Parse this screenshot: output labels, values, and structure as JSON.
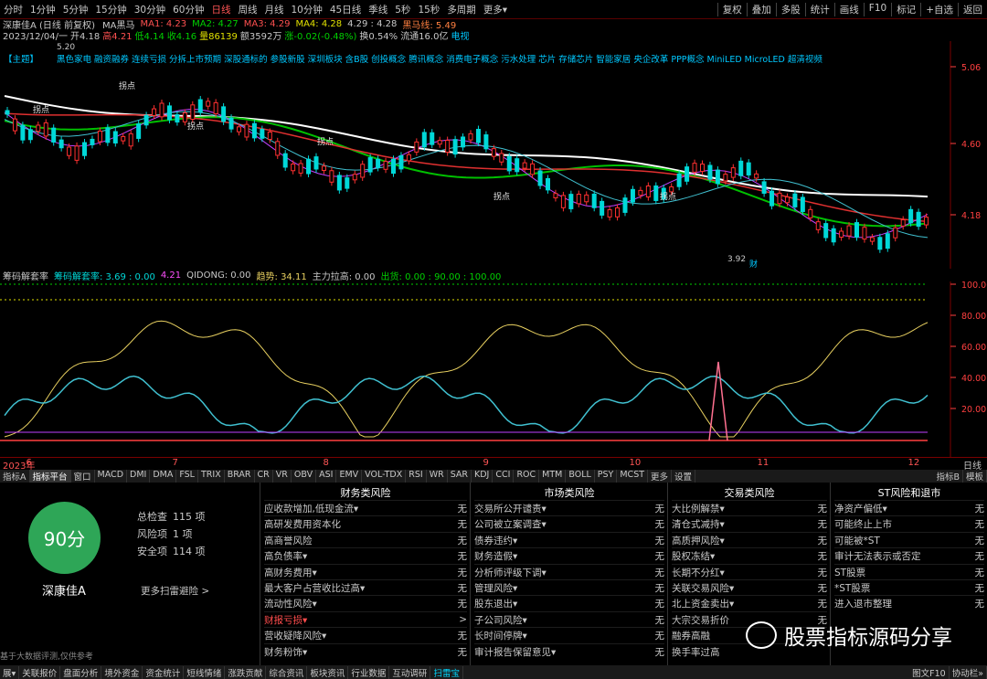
{
  "toolbar": {
    "periods": [
      "分时",
      "1分钟",
      "5分钟",
      "15分钟",
      "30分钟",
      "60分钟",
      "日线",
      "周线",
      "月线",
      "10分钟",
      "45日线",
      "季线",
      "5秒",
      "15秒",
      "多周期",
      "更多▾"
    ],
    "active_period": "日线",
    "right": [
      "复权",
      "叠加",
      "多股",
      "统计",
      "画线",
      "F10",
      "标记",
      "+自选",
      "返回"
    ]
  },
  "title_line": {
    "name": "深康佳A (日线 前复权)",
    "ma_label": "MA黑马",
    "ma1": "MA1: 4.23",
    "ma2": "MA2: 4.27",
    "ma3": "MA3: 4.29",
    "ma4": "MA4: 4.28",
    "extra": "4.29 : 4.28",
    "heima": "黑马线: 5.49"
  },
  "info_line": {
    "date": "2023/12/04/一",
    "open": "开4.18",
    "high": "高4.21",
    "low": "低4.14",
    "close": "收4.16",
    "vol": "量86139",
    "amount": "额3592万",
    "change": "涨-0.02(-0.48%)",
    "turnover": "换0.54%",
    "float": "流通16.0亿",
    "tv": "电视"
  },
  "concept_line": {
    "tag": "【主题】",
    "text": "黑色家电 融资融券 连续亏损 分拆上市预期 深股通标的 参股新股 深圳板块 含B股 创投概念 腾讯概念 消费电子概念 污水处理 芯片 存储芯片 智能家居 央企改革 PPP概念 MiniLED MicroLED 超清视频"
  },
  "price_axis": [
    "5.06",
    "4.60",
    "4.18"
  ],
  "price_marks": {
    "high": "5.20",
    "low": "3.92",
    "cai": "财"
  },
  "pick_labels": [
    "拐点",
    "拐点",
    "拐点",
    "拐点",
    "拐点",
    "拐点"
  ],
  "indicator_header": {
    "name": "筹码解套率",
    "v1": "筹码解套率: 3.69 : 0.00",
    "v2": "4.21",
    "qidong": "QIDONG: 0.00",
    "trend": "趋势: 34.11",
    "main": "主力拉高: 0.00",
    "out": "出货: 0.00 : 90.00 : 100.00"
  },
  "indicator_axis": [
    "100.00",
    "80.00",
    "60.00",
    "40.00",
    "20.00"
  ],
  "date_axis": {
    "year": "2023年",
    "months": [
      "6",
      "7",
      "8",
      "9",
      "10",
      "11",
      "12"
    ],
    "right": "日线"
  },
  "indicator_tabs": [
    "指标A",
    "指标平台",
    "窗口",
    "MACD",
    "DMI",
    "DMA",
    "FSL",
    "TRIX",
    "BRAR",
    "CR",
    "VR",
    "OBV",
    "ASI",
    "EMV",
    "VOL-TDX",
    "RSI",
    "WR",
    "SAR",
    "KDJ",
    "CCI",
    "ROC",
    "MTM",
    "BOLL",
    "PSY",
    "MCST",
    "更多",
    "设置"
  ],
  "indicator_tabs_right": [
    "指标B",
    "模板"
  ],
  "risk": {
    "score": "90分",
    "stock_name": "深康佳A",
    "total_label": "总检查",
    "total_val": "115 项",
    "risk_label": "风险项",
    "risk_val": "1 项",
    "safe_label": "安全项",
    "safe_val": "114 项",
    "more": "更多扫雷避险 >",
    "disclaimer": "基于大数据评测,仅供参考",
    "columns": [
      {
        "title": "财务类风险",
        "items": [
          {
            "name": "应收款增加,低现金流▾",
            "value": "无"
          },
          {
            "name": "高研发费用资本化",
            "value": "无"
          },
          {
            "name": "高商誉风险",
            "value": "无"
          },
          {
            "name": "高负债率▾",
            "value": "无"
          },
          {
            "name": "高财务费用▾",
            "value": "无"
          },
          {
            "name": "最大客户占营收比过高▾",
            "value": "无"
          },
          {
            "name": "流动性风险▾",
            "value": "无"
          },
          {
            "name": "财报亏损▾",
            "value": ">",
            "warn": true
          },
          {
            "name": "营收疑降风险▾",
            "value": "无"
          },
          {
            "name": "财务粉饰▾",
            "value": "无"
          }
        ]
      },
      {
        "title": "市场类风险",
        "items": [
          {
            "name": "交易所公开谴责▾",
            "value": "无"
          },
          {
            "name": "公司被立案调查▾",
            "value": "无"
          },
          {
            "name": "债券违约▾",
            "value": "无"
          },
          {
            "name": "财务造假▾",
            "value": "无"
          },
          {
            "name": "分析师评级下调▾",
            "value": "无"
          },
          {
            "name": "管理风险▾",
            "value": "无"
          },
          {
            "name": "股东退出▾",
            "value": "无"
          },
          {
            "name": "子公司风险▾",
            "value": "无"
          },
          {
            "name": "长时间停牌▾",
            "value": "无"
          },
          {
            "name": "审计报告保留意见▾",
            "value": "无"
          }
        ]
      },
      {
        "title": "交易类风险",
        "items": [
          {
            "name": "大比例解禁▾",
            "value": "无"
          },
          {
            "name": "清仓式减持▾",
            "value": "无"
          },
          {
            "name": "高质押风险▾",
            "value": "无"
          },
          {
            "name": "股权冻结▾",
            "value": "无"
          },
          {
            "name": "长期不分红▾",
            "value": "无"
          },
          {
            "name": "关联交易风险▾",
            "value": "无"
          },
          {
            "name": "北上资金卖出▾",
            "value": "无"
          },
          {
            "name": "大宗交易折价",
            "value": "无"
          },
          {
            "name": "融券高融",
            "value": ""
          },
          {
            "name": "换手率过高",
            "value": ""
          }
        ]
      },
      {
        "title": "ST风险和退市",
        "items": [
          {
            "name": "净资产偏低▾",
            "value": "无"
          },
          {
            "name": "可能终止上市",
            "value": "无"
          },
          {
            "name": "可能被*ST",
            "value": "无"
          },
          {
            "name": "审计无法表示或否定",
            "value": "无"
          },
          {
            "name": "ST股票",
            "value": "无"
          },
          {
            "name": "*ST股票",
            "value": "无"
          },
          {
            "name": "进入退市整理",
            "value": "无"
          }
        ]
      }
    ]
  },
  "watermark": "股票指标源码分享",
  "bottom_tabs": [
    "展▾",
    "关联报价",
    "盘面分析",
    "境外资金",
    "资金统计",
    "短线情绪",
    "涨跌贡献",
    "综合资讯",
    "板块资讯",
    "行业数据",
    "互动调研",
    "扫雷宝"
  ],
  "bottom_active": "扫雷宝",
  "bottom_right": [
    "图文F10",
    "协动栏»"
  ],
  "colors": {
    "accent_red": "#ff4d4d",
    "score_green": "#2ea657",
    "ma_white": "#ffffff",
    "ma_green": "#00d000",
    "ma_red": "#ff3030",
    "kdj_yellow": "#e8d060",
    "kdj_cyan": "#40c0d0"
  }
}
